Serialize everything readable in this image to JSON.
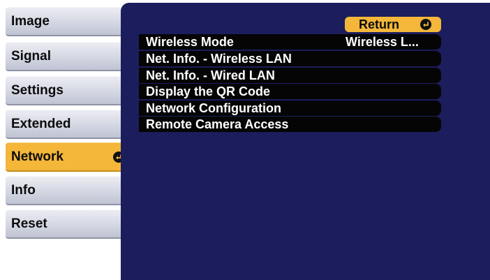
{
  "sidebar": {
    "tabs": [
      {
        "label": "Image"
      },
      {
        "label": "Signal"
      },
      {
        "label": "Settings"
      },
      {
        "label": "Extended"
      },
      {
        "label": "Network",
        "selected": true
      },
      {
        "label": "Info"
      },
      {
        "label": "Reset"
      }
    ]
  },
  "panel": {
    "return_label": "Return",
    "items": [
      {
        "label": "Wireless Mode",
        "value": "Wireless L..."
      },
      {
        "label": "Net. Info. - Wireless LAN"
      },
      {
        "label": "Net. Info. - Wired LAN"
      },
      {
        "label": "Display the QR Code"
      },
      {
        "label": "Network Configuration"
      },
      {
        "label": "Remote Camera Access"
      }
    ]
  },
  "colors": {
    "panel_background": "#1b1d5c",
    "selected_accent": "#f4b73a",
    "tab_background": "#d4d7e3",
    "row_background": "#050505"
  }
}
